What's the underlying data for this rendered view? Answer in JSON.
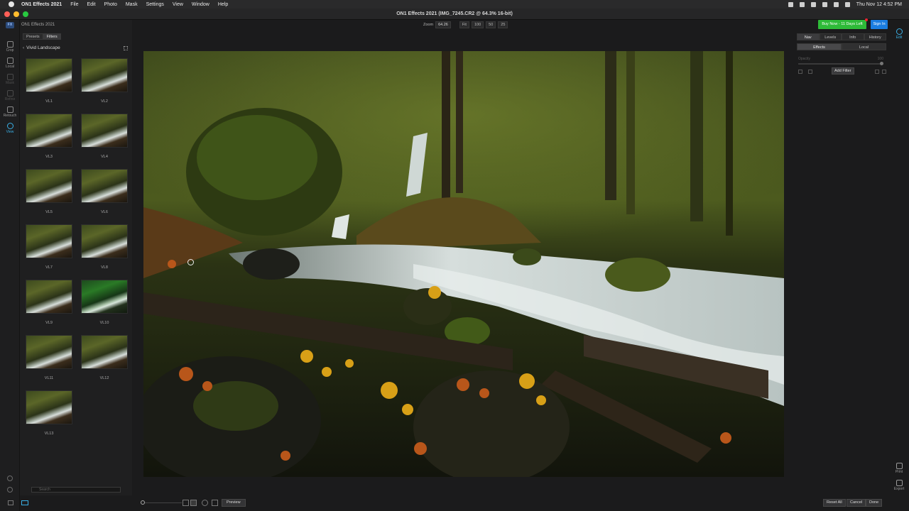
{
  "menubar": {
    "items": [
      "ON1 Effects 2021",
      "File",
      "Edit",
      "Photo",
      "Mask",
      "Settings",
      "View",
      "Window",
      "Help"
    ],
    "clock": "Thu Nov 12  4:52 PM"
  },
  "window": {
    "title": "ON1 Effects 2021 (IMG_7245.CR2 @ 64.3% 16-bit)"
  },
  "colors": {
    "accent": "#3ab0e6",
    "buy_button": "#2ebb38",
    "signin_button": "#1a7de0",
    "close": "#ff5f57",
    "minimize": "#febc2e",
    "maximize": "#28c840"
  },
  "toolstrip": {
    "logo": "FX",
    "tools": [
      {
        "label": "Crop",
        "icon": "crop-icon",
        "state": "normal"
      },
      {
        "label": "Local",
        "icon": "brush-icon",
        "state": "normal"
      },
      {
        "label": "Mask",
        "icon": "mask-icon",
        "state": "dim"
      },
      {
        "label": "Refine",
        "icon": "refine-icon",
        "state": "dim"
      },
      {
        "label": "Retouch",
        "icon": "retouch-icon",
        "state": "normal"
      },
      {
        "label": "View",
        "icon": "view-icon",
        "state": "active"
      }
    ]
  },
  "browser": {
    "app_name": "ON1 Effects 2021",
    "tabs": [
      "Presets",
      "Filters"
    ],
    "active_tab": "Filters",
    "breadcrumb": "Vivid Landscape",
    "thumbnails": [
      "VL1",
      "VL2",
      "VL3",
      "VL4",
      "VL5",
      "VL6",
      "VL7",
      "VL8",
      "VL9",
      "VL10",
      "VL11",
      "VL12",
      "VL13"
    ],
    "search_placeholder": "Search"
  },
  "zoombar": {
    "zoom_label": "Zoom",
    "zoom_value": "64.26",
    "buttons": [
      "Fit",
      "100",
      "50",
      "25"
    ]
  },
  "header_buttons": {
    "buy_now": "Buy Now - 11 Days Left",
    "sign_in": "Sign In"
  },
  "rightpanel": {
    "tabs": [
      "Nav",
      "Levels",
      "Info",
      "History"
    ],
    "active_tab": "Nav",
    "subtabs": [
      "Effects",
      "Local"
    ],
    "active_subtab": "Effects",
    "opacity_label": "Opacity",
    "opacity_value": "100",
    "add_filter": "Add Filter"
  },
  "modules": [
    {
      "label": "Edit",
      "icon": "gear-icon",
      "active": true
    },
    {
      "label": "Print",
      "icon": "printer-icon",
      "active": false
    },
    {
      "label": "Export",
      "icon": "export-icon",
      "active": false
    }
  ],
  "bottombar": {
    "preview": "Preview",
    "reset_all": "Reset All",
    "cancel": "Cancel",
    "done": "Done"
  }
}
